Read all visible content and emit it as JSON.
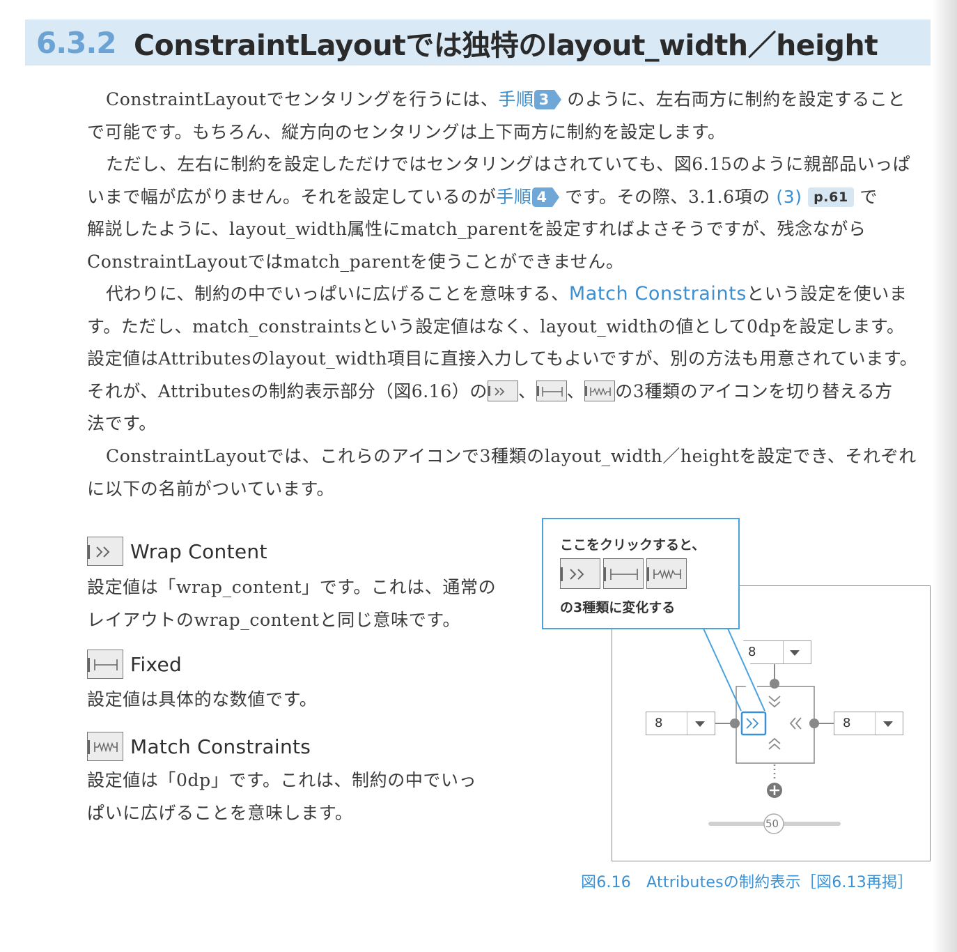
{
  "heading": {
    "number": "6.3.2",
    "title": "ConstraintLayoutでは独特のlayout_width／height"
  },
  "paragraph1": {
    "l1_a": "ConstraintLayoutでセンタリングを行うには、",
    "l1_step_label": "手順",
    "l1_step_num": "3",
    "l1_b": "のように、左右両方に制約を設定すること",
    "l2": "で可能です。もちろん、縦方向のセンタリングは上下両方に制約を設定します。"
  },
  "paragraph2": {
    "l1": "ただし、左右に制約を設定しただけではセンタリングはされていても、図6.15のように親部品いっぱ",
    "l2_a": "いまで幅が広がりません。それを設定しているのが",
    "l2_step_label": "手順",
    "l2_step_num": "4",
    "l2_b": "です。その際、3.1.6項の",
    "l2_ref": "(3)",
    "l2_page": "p.61",
    "l2_c": "で",
    "l3": "解説したように、layout_width属性にmatch_parentを設定すればよさそうですが、残念ながら",
    "l4": "ConstraintLayoutではmatch_parentを使うことができません。"
  },
  "paragraph3": {
    "l1_a": "代わりに、制約の中でいっぱいに広げることを意味する、",
    "l1_term": "Match Constraints",
    "l1_b": "という設定を使いま",
    "l2": "す。ただし、match_constraintsという設定値はなく、layout_widthの値として0dpを設定します。",
    "l3": "設定値はAttributesのlayout_width項目に直接入力してもよいですが、別の方法も用意されています。",
    "l4_a": "それが、Attributesの制約表示部分（図6.16）の",
    "l4_sep1": "、",
    "l4_sep2": "、",
    "l4_b": "の3種類のアイコンを切り替える方",
    "l5": "法です。"
  },
  "paragraph4": {
    "l1": "ConstraintLayoutでは、これらのアイコンで3種類のlayout_width／heightを設定でき、それぞれ",
    "l2": "に以下の名前がついています。"
  },
  "definitions": [
    {
      "icon": "wrap-content-icon",
      "title": "Wrap Content",
      "l1": "設定値は「wrap_content」です。これは、通常の",
      "l2": "レイアウトのwrap_contentと同じ意味です。"
    },
    {
      "icon": "fixed-icon",
      "title": "Fixed",
      "l1": "設定値は具体的な数値です。",
      "l2": ""
    },
    {
      "icon": "match-constraints-icon",
      "title": "Match Constraints",
      "l1": "設定値は「0dp」です。これは、制約の中でいっ",
      "l2": "ぱいに広げることを意味します。"
    }
  ],
  "figure": {
    "callout_top": "ここをクリックすると、",
    "callout_bottom": "の3種類に変化する",
    "top_margin": "8",
    "left_margin": "8",
    "right_margin": "8",
    "bias": "50",
    "caption": "図6.16　Attributesの制約表示［図6.13再掲］"
  },
  "colors": {
    "accent": "#3a90d2",
    "heading_bg": "#d9e9f5",
    "heading_num": "#6aa3d4",
    "callout_border": "#4aa2dc"
  }
}
